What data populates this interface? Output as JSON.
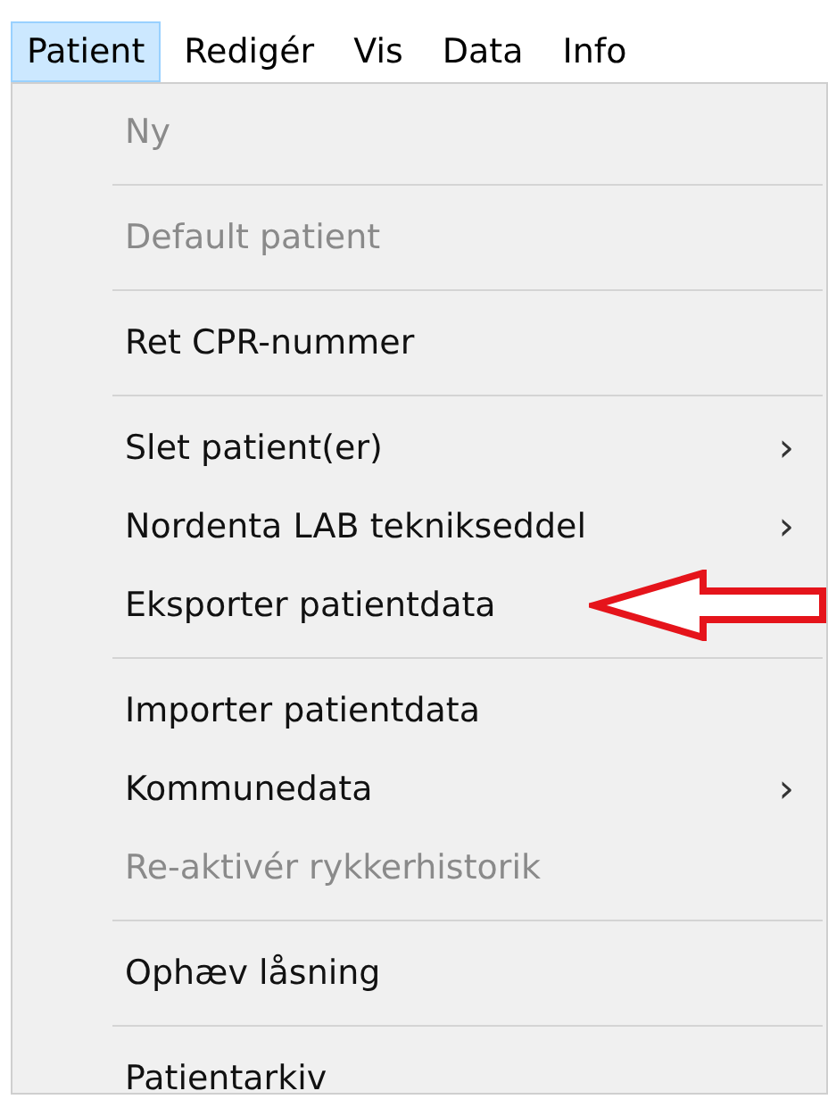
{
  "menu_bar": [
    {
      "label": "Patient",
      "selected": true
    },
    {
      "label": "Redigér",
      "selected": false
    },
    {
      "label": "Vis",
      "selected": false
    },
    {
      "label": "Data",
      "selected": false
    },
    {
      "label": "Info",
      "selected": false
    }
  ],
  "menu": {
    "items": [
      {
        "kind": "item",
        "label": "Ny",
        "disabled": true
      },
      {
        "kind": "separator"
      },
      {
        "kind": "item",
        "label": "Default patient",
        "disabled": true
      },
      {
        "kind": "separator"
      },
      {
        "kind": "item",
        "label": "Ret CPR-nummer",
        "disabled": false
      },
      {
        "kind": "separator"
      },
      {
        "kind": "item",
        "label": "Slet patient(er)",
        "disabled": false,
        "arrow": "›"
      },
      {
        "kind": "item",
        "label": "Nordenta LAB teknikseddel",
        "disabled": false,
        "arrow": "›"
      },
      {
        "kind": "item",
        "label": "Eksporter patientdata",
        "disabled": false
      },
      {
        "kind": "separator"
      },
      {
        "kind": "item",
        "label": "Importer patientdata",
        "disabled": false
      },
      {
        "kind": "item",
        "label": "Kommunedata",
        "disabled": false,
        "arrow": "›"
      },
      {
        "kind": "item",
        "label": "Re-aktivér rykkerhistorik",
        "disabled": true
      },
      {
        "kind": "separator"
      },
      {
        "kind": "item",
        "label": "Ophæv låsning",
        "disabled": false
      },
      {
        "kind": "separator"
      },
      {
        "kind": "item",
        "label": "Patientarkiv",
        "disabled": false
      }
    ]
  }
}
